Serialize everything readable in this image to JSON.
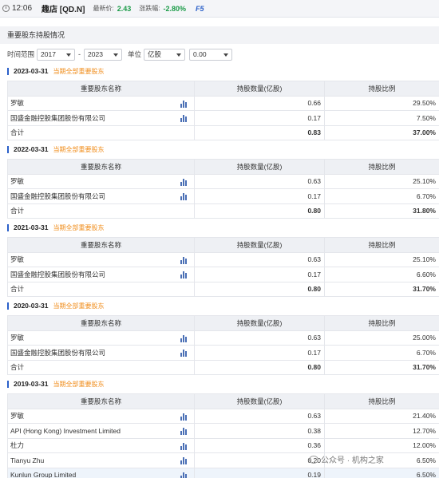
{
  "topbar": {
    "time": "12:06",
    "stock": "趣店 [QD.N]",
    "price_label": "最新价:",
    "price": "2.43",
    "change_label": "涨跌幅:",
    "change": "-2.80%",
    "refresh": "F5"
  },
  "section_title": "重要股东持股情况",
  "filter": {
    "range_label": "时间范围",
    "from": "2017",
    "sep": "-",
    "to": "2023",
    "unit_label": "单位",
    "unit": "亿股",
    "threshold": "0.00"
  },
  "tag_text": "当期全部重要股东",
  "columns": [
    "重要股东名称",
    "持股数量(亿股)",
    "持股比例"
  ],
  "periods": [
    {
      "date": "2023-03-31",
      "rows": [
        {
          "name": "罗敏",
          "shares": "0.66",
          "ratio": "29.50%"
        },
        {
          "name": "国盛金融控股集团股份有限公司",
          "shares": "0.17",
          "ratio": "7.50%"
        }
      ],
      "total": {
        "name": "合计",
        "shares": "0.83",
        "ratio": "37.00%"
      }
    },
    {
      "date": "2022-03-31",
      "rows": [
        {
          "name": "罗敏",
          "shares": "0.63",
          "ratio": "25.10%"
        },
        {
          "name": "国盛金融控股集团股份有限公司",
          "shares": "0.17",
          "ratio": "6.70%"
        }
      ],
      "total": {
        "name": "合计",
        "shares": "0.80",
        "ratio": "31.80%"
      }
    },
    {
      "date": "2021-03-31",
      "rows": [
        {
          "name": "罗敏",
          "shares": "0.63",
          "ratio": "25.10%"
        },
        {
          "name": "国盛金融控股集团股份有限公司",
          "shares": "0.17",
          "ratio": "6.60%"
        }
      ],
      "total": {
        "name": "合计",
        "shares": "0.80",
        "ratio": "31.70%"
      }
    },
    {
      "date": "2020-03-31",
      "rows": [
        {
          "name": "罗敏",
          "shares": "0.63",
          "ratio": "25.00%"
        },
        {
          "name": "国盛金融控股集团股份有限公司",
          "shares": "0.17",
          "ratio": "6.70%"
        }
      ],
      "total": {
        "name": "合计",
        "shares": "0.80",
        "ratio": "31.70%"
      }
    },
    {
      "date": "2019-03-31",
      "rows": [
        {
          "name": "罗敏",
          "shares": "0.63",
          "ratio": "21.40%"
        },
        {
          "name": "API (Hong Kong) Investment Limited",
          "shares": "0.38",
          "ratio": "12.70%"
        },
        {
          "name": "杜力",
          "shares": "0.36",
          "ratio": "12.00%"
        },
        {
          "name": "Tianyu Zhu",
          "shares": "0.20",
          "ratio": "6.50%"
        },
        {
          "name": "Kunlun Group Limited",
          "shares": "0.19",
          "ratio": "6.50%"
        }
      ]
    }
  ],
  "watermark": "公众号 · 机构之家"
}
